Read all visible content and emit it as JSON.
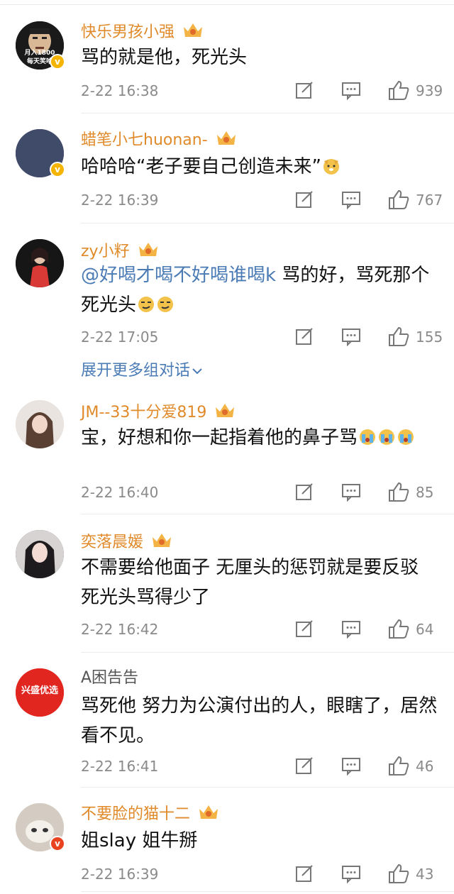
{
  "comments": [
    {
      "username": "快乐男孩小强",
      "avatar_text_1": "月入1800",
      "avatar_text_2": "每天笑哈",
      "text": "骂的就是他，死光头",
      "time": "2-22 16:38",
      "likes": "939"
    },
    {
      "username": "蜡笔小七huonan-",
      "text": "哈哈哈“老子要自己创造未来”",
      "time": "2-22 16:39",
      "likes": "767"
    },
    {
      "username": "zy小籽",
      "mention": "@好喝才喝不好喝谁喝k",
      "text": " 骂的好，骂死那个死光头",
      "time": "2-22 17:05",
      "likes": "155"
    },
    {
      "username": "JM--33十分爱819",
      "text": "宝，好想和你一起指着他的鼻子骂",
      "time": "2-22 16:40",
      "likes": "85"
    },
    {
      "username": "奕落晨媛",
      "text": "不需要给他面子 无厘头的惩罚就是要反驳 死光头骂得少了",
      "time": "2-22 16:42",
      "likes": "64"
    },
    {
      "username": "A困告告",
      "avatar_text_1": "兴盛优选",
      "text": "骂死他  努力为公演付出的人，眼瞎了，居然看不见。",
      "time": "2-22 16:41",
      "likes": "46"
    },
    {
      "username": "不要脸的猫十二",
      "text": "姐slay 姐牛掰",
      "time": "2-22 16:39",
      "likes": "43"
    }
  ],
  "expand_label": "展开更多组对话",
  "icons": {
    "share": "edit-share-icon",
    "comment": "comment-icon",
    "like": "thumbs-up-icon",
    "crown": "crown-badge-icon",
    "verified": "verified-v-icon",
    "chevron": "chevron-down-icon"
  },
  "colors": {
    "username": "#e08a2a",
    "mention": "#4a7bb5",
    "meta": "#8a8a8a",
    "verified": "#f5b400"
  }
}
